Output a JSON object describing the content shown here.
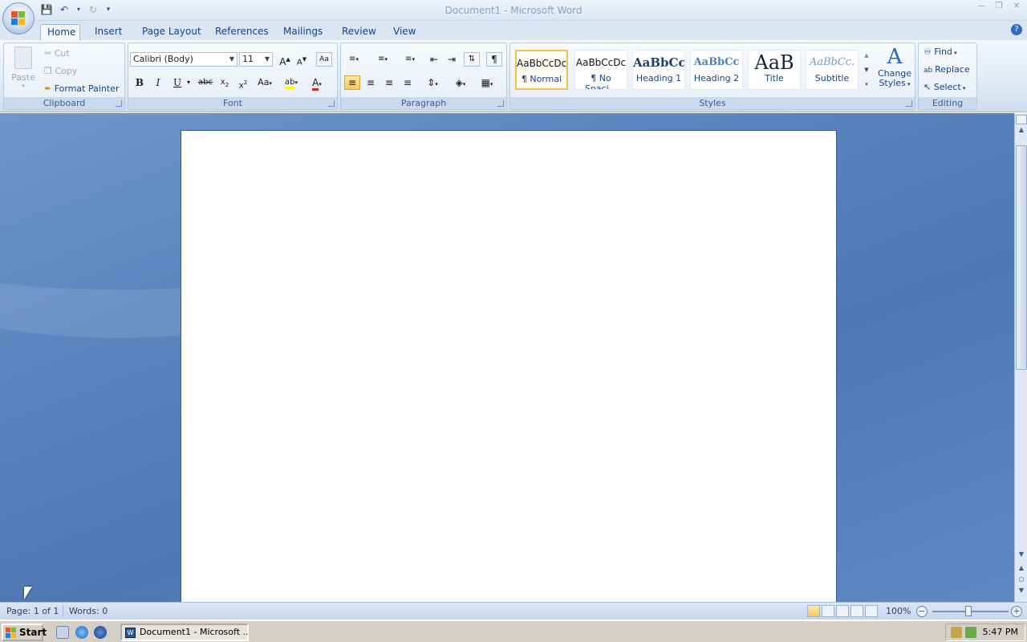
{
  "window": {
    "title": "Document1 - Microsoft Word"
  },
  "qat": {
    "save": "save-icon",
    "undo": "undo-icon",
    "redo": "redo-icon",
    "customize": "qat-menu-icon"
  },
  "tabs": [
    "Home",
    "Insert",
    "Page Layout",
    "References",
    "Mailings",
    "Review",
    "View"
  ],
  "active_tab": "Home",
  "clipboard": {
    "label": "Clipboard",
    "paste": "Paste",
    "cut": "Cut",
    "copy": "Copy",
    "format_painter": "Format Painter"
  },
  "font": {
    "label": "Font",
    "font_name": "Calibri (Body)",
    "font_size": "11"
  },
  "paragraph": {
    "label": "Paragraph"
  },
  "styles": {
    "label": "Styles",
    "items": [
      {
        "preview": "AaBbCcDc",
        "name": "¶ Normal"
      },
      {
        "preview": "AaBbCcDc",
        "name": "¶ No Spaci..."
      },
      {
        "preview": "AaBbCc",
        "name": "Heading 1"
      },
      {
        "preview": "AaBbCc",
        "name": "Heading 2"
      },
      {
        "preview": "AaB",
        "name": "Title"
      },
      {
        "preview": "AaBbCc.",
        "name": "Subtitle"
      }
    ],
    "change_styles_line1": "Change",
    "change_styles_line2": "Styles"
  },
  "editing": {
    "label": "Editing",
    "find": "Find",
    "replace": "Replace",
    "select": "Select"
  },
  "statusbar": {
    "page": "Page: 1 of 1",
    "words": "Words: 0",
    "zoom": "100%"
  },
  "taskbar": {
    "start": "Start",
    "task_doc": "Document1 - Microsoft ...",
    "clock": "5:47 PM"
  },
  "colors": {
    "ribbon": "#dde8f5",
    "accent": "#15428b",
    "doc_bg": "#5c85bf",
    "highlight": "#ffff00",
    "font_color": "#e02020"
  }
}
